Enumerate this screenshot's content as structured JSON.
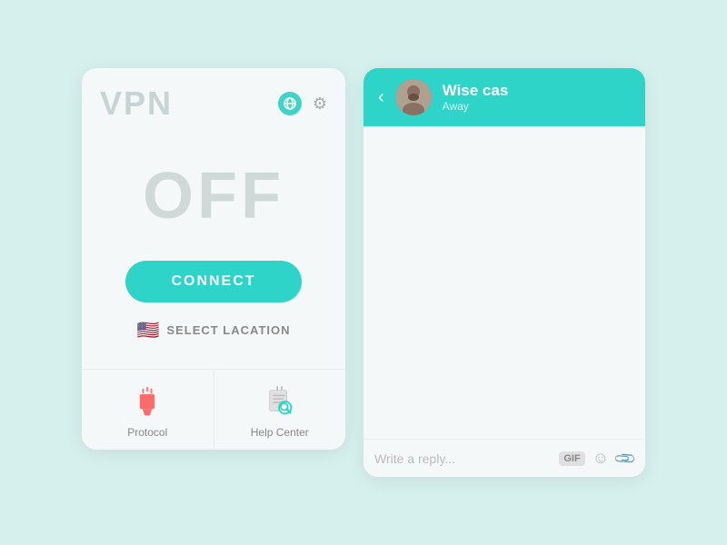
{
  "vpn": {
    "title": "VPN",
    "status": "OFF",
    "connect_label": "CONNECT",
    "select_location_label": "SELECT LACATION",
    "footer": [
      {
        "id": "protocol",
        "label": "Protocol"
      },
      {
        "id": "help-center",
        "label": "Help Center"
      }
    ]
  },
  "chat": {
    "contact_name": "Wise cas",
    "contact_status": "Away",
    "input_placeholder": "Write a reply...",
    "gif_label": "GIF",
    "back_arrow": "‹"
  },
  "colors": {
    "accent": "#2ed4c8",
    "bg": "#d6f0ee"
  }
}
